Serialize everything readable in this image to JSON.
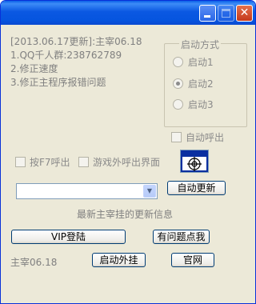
{
  "window": {
    "title": ""
  },
  "info": {
    "lines": [
      "[2013.06.17更新]:主宰06.18",
      "1.QQ千人群:238762789",
      "2.修正速度",
      "3.修正主程序报错问题"
    ]
  },
  "launch_mode": {
    "title": "启动方式",
    "options": [
      "启动1",
      "启动2",
      "启动3"
    ],
    "selected": "启动2"
  },
  "auto_call_label": "自动呼出",
  "hotkey_label": "按F7呼出",
  "game_call_label": "游戏外呼出界面",
  "auto_update_label": "自动更新",
  "combo_value": "",
  "update_caption": "最新主宰挂的更新信息",
  "vip_label": "VIP登陆",
  "question_label": "有问题点我",
  "version_label": "主宰06.18",
  "start_label": "启动外挂",
  "website_label": "官网",
  "icons": {
    "title_buttons": [
      "minimize-icon",
      "maximize-icon",
      "close-icon"
    ],
    "target": "crosshair-icon"
  }
}
